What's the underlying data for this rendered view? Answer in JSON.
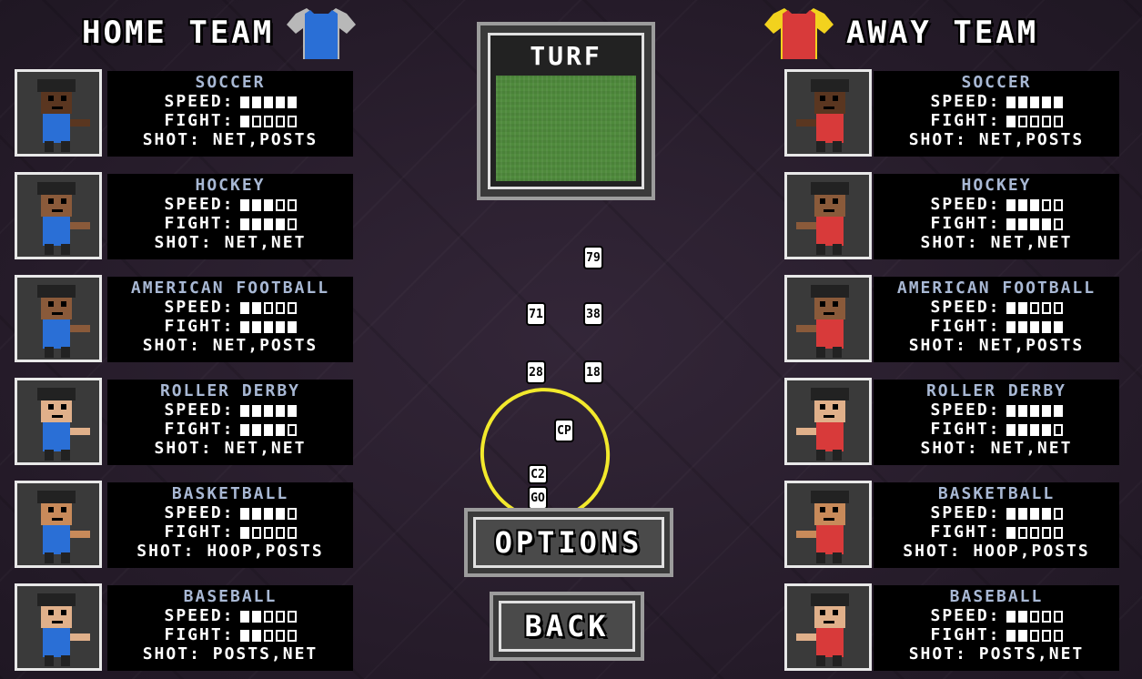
{
  "home": {
    "title": "HOME TEAM",
    "jersey_color": "#2a6fd6",
    "players": [
      {
        "sport": "SOCCER",
        "speed_label": "SPEED:",
        "speed": 5,
        "fight_label": "FIGHT:",
        "fight": 1,
        "shot": "SHOT: NET,POSTS",
        "skin": "#5a3620",
        "uniform": "#2a6fd6",
        "icon": "soccer-player-icon"
      },
      {
        "sport": "HOCKEY",
        "speed_label": "SPEED:",
        "speed": 3,
        "fight_label": "FIGHT:",
        "fight": 4,
        "shot": "SHOT: NET,NET",
        "skin": "#8a5a3a",
        "uniform": "#2a6fd6",
        "icon": "hockey-player-icon"
      },
      {
        "sport": "AMERICAN FOOTBALL",
        "speed_label": "SPEED:",
        "speed": 2,
        "fight_label": "FIGHT:",
        "fight": 5,
        "shot": "SHOT: NET,POSTS",
        "skin": "#8a5a3a",
        "uniform": "#2a6fd6",
        "icon": "football-player-icon"
      },
      {
        "sport": "ROLLER DERBY",
        "speed_label": "SPEED:",
        "speed": 5,
        "fight_label": "FIGHT:",
        "fight": 4,
        "shot": "SHOT: NET,NET",
        "skin": "#e0b08a",
        "uniform": "#2a6fd6",
        "icon": "roller-derby-player-icon"
      },
      {
        "sport": "BASKETBALL",
        "speed_label": "SPEED:",
        "speed": 4,
        "fight_label": "FIGHT:",
        "fight": 1,
        "shot": "SHOT: HOOP,POSTS",
        "skin": "#c88a5a",
        "uniform": "#2a6fd6",
        "icon": "basketball-player-icon"
      },
      {
        "sport": "BASEBALL",
        "speed_label": "SPEED:",
        "speed": 2,
        "fight_label": "FIGHT:",
        "fight": 2,
        "shot": "SHOT: POSTS,NET",
        "skin": "#e0b08a",
        "uniform": "#2a6fd6",
        "icon": "baseball-player-icon"
      }
    ]
  },
  "away": {
    "title": "AWAY TEAM",
    "jersey_color": "#d83a3a",
    "jersey_collar": "#f2d21e",
    "players": [
      {
        "sport": "SOCCER",
        "speed_label": "SPEED:",
        "speed": 5,
        "fight_label": "FIGHT:",
        "fight": 1,
        "shot": "SHOT: NET,POSTS",
        "skin": "#5a3620",
        "uniform": "#d83a3a",
        "icon": "soccer-player-icon"
      },
      {
        "sport": "HOCKEY",
        "speed_label": "SPEED:",
        "speed": 3,
        "fight_label": "FIGHT:",
        "fight": 4,
        "shot": "SHOT: NET,NET",
        "skin": "#8a5a3a",
        "uniform": "#d83a3a",
        "icon": "hockey-player-icon"
      },
      {
        "sport": "AMERICAN FOOTBALL",
        "speed_label": "SPEED:",
        "speed": 2,
        "fight_label": "FIGHT:",
        "fight": 5,
        "shot": "SHOT: NET,POSTS",
        "skin": "#8a5a3a",
        "uniform": "#d83a3a",
        "icon": "football-player-icon"
      },
      {
        "sport": "ROLLER DERBY",
        "speed_label": "SPEED:",
        "speed": 5,
        "fight_label": "FIGHT:",
        "fight": 4,
        "shot": "SHOT: NET,NET",
        "skin": "#e0b08a",
        "uniform": "#d83a3a",
        "icon": "roller-derby-player-icon"
      },
      {
        "sport": "BASKETBALL",
        "speed_label": "SPEED:",
        "speed": 4,
        "fight_label": "FIGHT:",
        "fight": 1,
        "shot": "SHOT: HOOP,POSTS",
        "skin": "#c88a5a",
        "uniform": "#d83a3a",
        "icon": "basketball-player-icon"
      },
      {
        "sport": "BASEBALL",
        "speed_label": "SPEED:",
        "speed": 2,
        "fight_label": "FIGHT:",
        "fight": 2,
        "shot": "SHOT: POSTS,NET",
        "skin": "#e0b08a",
        "uniform": "#d83a3a",
        "icon": "baseball-player-icon"
      }
    ]
  },
  "turf": {
    "label": "TURF",
    "color": "#4f8a3c"
  },
  "tags": [
    "79",
    "71",
    "38",
    "28",
    "18",
    "CP",
    "C2",
    "GO"
  ],
  "highlight_color": "#f2e92c",
  "buttons": {
    "options": "OPTIONS",
    "back": "BACK"
  }
}
